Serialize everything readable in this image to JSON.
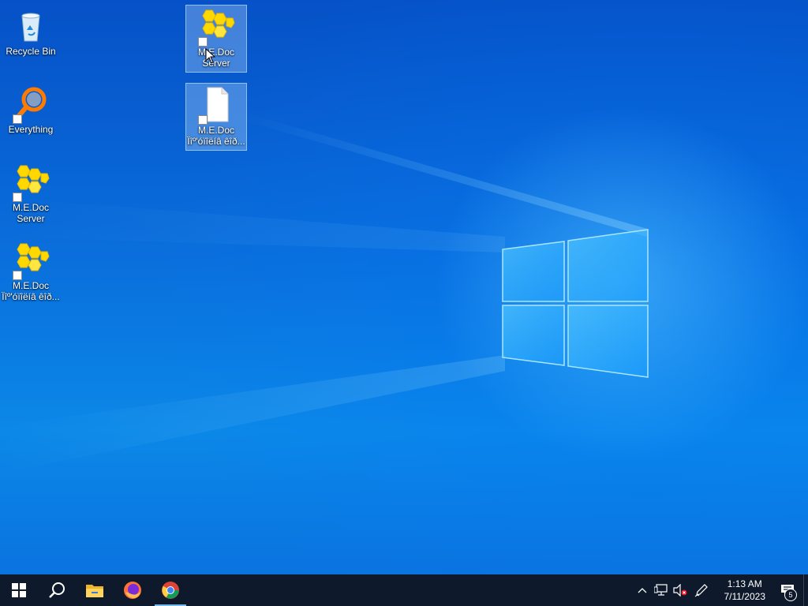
{
  "desktop": {
    "icons": [
      {
        "label": "Recycle Bin",
        "icon": "recycle-bin-icon"
      },
      {
        "label": "Everything",
        "icon": "everything-search-icon"
      },
      {
        "label": "M.E.Doc Server",
        "icon": "medoc-icon"
      },
      {
        "label": "M.E.Doc Ïîº'óïîëíâ êîð...",
        "icon": "medoc-icon"
      },
      {
        "label": "M.E.Doc Server",
        "icon": "medoc-icon",
        "selected": true
      },
      {
        "label": "M.E.Doc Ïîº'óïîëíâ êîð...",
        "icon": "blank-file-icon",
        "selected": true
      }
    ]
  },
  "taskbar": {
    "apps": [
      "start-icon",
      "search-icon",
      "file-explorer-icon",
      "firefox-icon",
      "chrome-icon"
    ],
    "active_app": "chrome-icon"
  },
  "tray": {
    "time": "1:13 AM",
    "date": "7/11/2023",
    "notification_count": "5"
  },
  "colors": {
    "taskbar": "#0e1a2b",
    "medoc_yellow": "#ffd800",
    "accent": "#76b9ed"
  }
}
